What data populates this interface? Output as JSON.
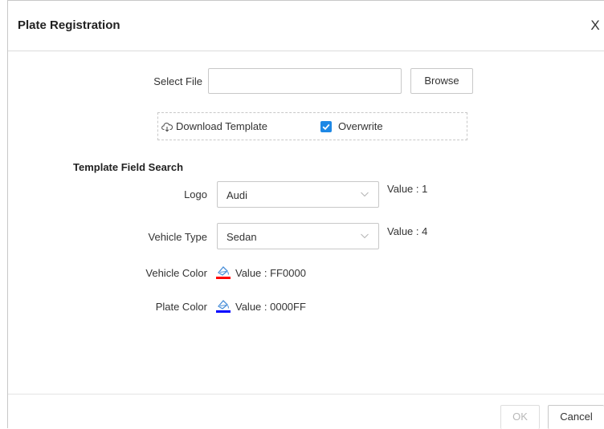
{
  "dialog": {
    "title": "Plate Registration",
    "close_label": "X"
  },
  "file": {
    "label": "Select File",
    "value": "",
    "placeholder": "",
    "browse_label": "Browse"
  },
  "options": {
    "download_template_label": "Download Template",
    "overwrite_label": "Overwrite",
    "overwrite_checked": true
  },
  "template_search": {
    "title": "Template Field Search",
    "logo": {
      "label": "Logo",
      "selected": "Audi",
      "value_text": "Value : 1"
    },
    "vehicle_type": {
      "label": "Vehicle Type",
      "selected": "Sedan",
      "value_text": "Value : 4"
    },
    "vehicle_color": {
      "label": "Vehicle Color",
      "value_text": "Value : FF0000",
      "color": "#ff0000"
    },
    "plate_color": {
      "label": "Plate Color",
      "value_text": "Value : 0000FF",
      "color": "#0000ff"
    }
  },
  "footer": {
    "ok_label": "OK",
    "cancel_label": "Cancel"
  },
  "colors": {
    "accent": "#1e88e5",
    "border": "#c8c8c8"
  }
}
